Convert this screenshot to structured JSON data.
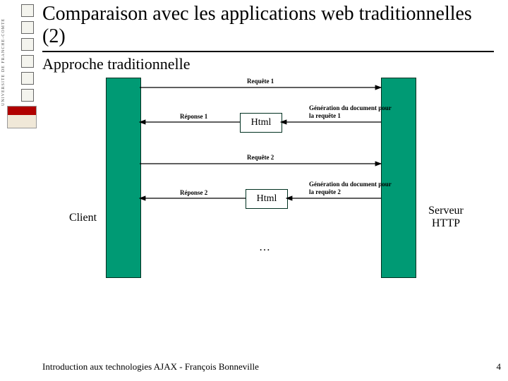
{
  "title": "Comparaison avec les applications web traditionnelles (2)",
  "subtitle": "Approche traditionnelle",
  "client_label": "Client",
  "server_label": "Serveur HTTP",
  "html_label_1": "Html",
  "html_label_2": "Html",
  "req1": "Requête 1",
  "resp1": "Réponse 1",
  "gen1": "Génération du document pour la requête 1",
  "req2": "Requête 2",
  "resp2": "Réponse 2",
  "gen2": "Génération du document pour la requête 2",
  "dots": "…",
  "footer": "Introduction aux technologies AJAX - François Bonneville",
  "page_number": "4",
  "left_strip_text": "UNIVERSITE DE FRANCHE-COMTE"
}
